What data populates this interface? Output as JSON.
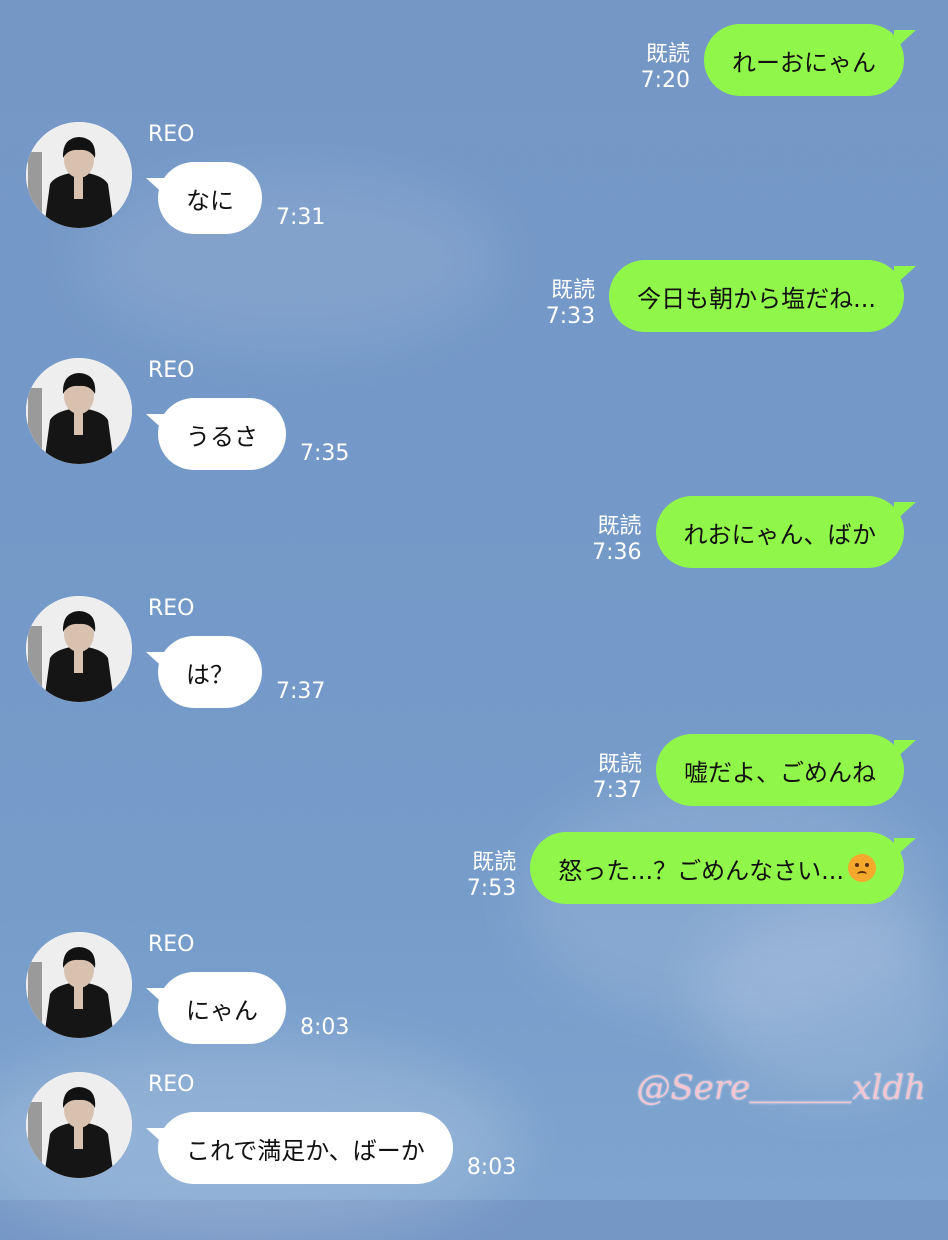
{
  "read_label": "既読",
  "sender_name": "REO",
  "messages": [
    {
      "dir": "out",
      "text": "れーおにゃん",
      "time": "7:20"
    },
    {
      "dir": "in",
      "text": "なに",
      "time": "7:31"
    },
    {
      "dir": "out",
      "text": "今日も朝から塩だね...",
      "time": "7:33"
    },
    {
      "dir": "in",
      "text": "うるさ",
      "time": "7:35"
    },
    {
      "dir": "out",
      "text": "れおにゃん、ばか",
      "time": "7:36"
    },
    {
      "dir": "in",
      "text": "は？",
      "time": "7:37"
    },
    {
      "dir": "out",
      "text": "嘘だよ、ごめんね",
      "time": "7:37"
    },
    {
      "dir": "out",
      "text": "怒った...？ごめんなさい...",
      "time": "7:53",
      "emoji": "worried-face-icon"
    },
    {
      "dir": "in",
      "text": "にゃん",
      "time": "8:03"
    },
    {
      "dir": "in",
      "text": "これで満足か、ばーか",
      "time": "8:03"
    }
  ],
  "watermark": "@Sere＿＿＿xldh",
  "colors": {
    "outgoing_bubble": "#90f74a",
    "incoming_bubble": "#ffffff",
    "background": "#7499c8"
  }
}
